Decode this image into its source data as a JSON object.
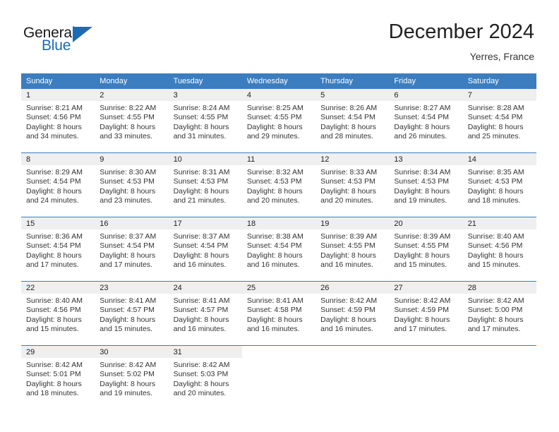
{
  "brand": {
    "name_part1": "General",
    "name_part2": "Blue",
    "triangle_icon": "triangle-icon",
    "accent_color": "#1b6cb5"
  },
  "header": {
    "title": "December 2024",
    "subtitle": "Yerres, France"
  },
  "theme": {
    "header_blue": "#3b7dbf",
    "daynum_band": "#efefef",
    "text": "#333333"
  },
  "weekday_headers": [
    "Sunday",
    "Monday",
    "Tuesday",
    "Wednesday",
    "Thursday",
    "Friday",
    "Saturday"
  ],
  "weeks": [
    [
      {
        "day": "1",
        "sunrise": "Sunrise: 8:21 AM",
        "sunset": "Sunset: 4:56 PM",
        "daylight_1": "Daylight: 8 hours",
        "daylight_2": "and 34 minutes."
      },
      {
        "day": "2",
        "sunrise": "Sunrise: 8:22 AM",
        "sunset": "Sunset: 4:55 PM",
        "daylight_1": "Daylight: 8 hours",
        "daylight_2": "and 33 minutes."
      },
      {
        "day": "3",
        "sunrise": "Sunrise: 8:24 AM",
        "sunset": "Sunset: 4:55 PM",
        "daylight_1": "Daylight: 8 hours",
        "daylight_2": "and 31 minutes."
      },
      {
        "day": "4",
        "sunrise": "Sunrise: 8:25 AM",
        "sunset": "Sunset: 4:55 PM",
        "daylight_1": "Daylight: 8 hours",
        "daylight_2": "and 29 minutes."
      },
      {
        "day": "5",
        "sunrise": "Sunrise: 8:26 AM",
        "sunset": "Sunset: 4:54 PM",
        "daylight_1": "Daylight: 8 hours",
        "daylight_2": "and 28 minutes."
      },
      {
        "day": "6",
        "sunrise": "Sunrise: 8:27 AM",
        "sunset": "Sunset: 4:54 PM",
        "daylight_1": "Daylight: 8 hours",
        "daylight_2": "and 26 minutes."
      },
      {
        "day": "7",
        "sunrise": "Sunrise: 8:28 AM",
        "sunset": "Sunset: 4:54 PM",
        "daylight_1": "Daylight: 8 hours",
        "daylight_2": "and 25 minutes."
      }
    ],
    [
      {
        "day": "8",
        "sunrise": "Sunrise: 8:29 AM",
        "sunset": "Sunset: 4:54 PM",
        "daylight_1": "Daylight: 8 hours",
        "daylight_2": "and 24 minutes."
      },
      {
        "day": "9",
        "sunrise": "Sunrise: 8:30 AM",
        "sunset": "Sunset: 4:53 PM",
        "daylight_1": "Daylight: 8 hours",
        "daylight_2": "and 23 minutes."
      },
      {
        "day": "10",
        "sunrise": "Sunrise: 8:31 AM",
        "sunset": "Sunset: 4:53 PM",
        "daylight_1": "Daylight: 8 hours",
        "daylight_2": "and 21 minutes."
      },
      {
        "day": "11",
        "sunrise": "Sunrise: 8:32 AM",
        "sunset": "Sunset: 4:53 PM",
        "daylight_1": "Daylight: 8 hours",
        "daylight_2": "and 20 minutes."
      },
      {
        "day": "12",
        "sunrise": "Sunrise: 8:33 AM",
        "sunset": "Sunset: 4:53 PM",
        "daylight_1": "Daylight: 8 hours",
        "daylight_2": "and 20 minutes."
      },
      {
        "day": "13",
        "sunrise": "Sunrise: 8:34 AM",
        "sunset": "Sunset: 4:53 PM",
        "daylight_1": "Daylight: 8 hours",
        "daylight_2": "and 19 minutes."
      },
      {
        "day": "14",
        "sunrise": "Sunrise: 8:35 AM",
        "sunset": "Sunset: 4:53 PM",
        "daylight_1": "Daylight: 8 hours",
        "daylight_2": "and 18 minutes."
      }
    ],
    [
      {
        "day": "15",
        "sunrise": "Sunrise: 8:36 AM",
        "sunset": "Sunset: 4:54 PM",
        "daylight_1": "Daylight: 8 hours",
        "daylight_2": "and 17 minutes."
      },
      {
        "day": "16",
        "sunrise": "Sunrise: 8:37 AM",
        "sunset": "Sunset: 4:54 PM",
        "daylight_1": "Daylight: 8 hours",
        "daylight_2": "and 17 minutes."
      },
      {
        "day": "17",
        "sunrise": "Sunrise: 8:37 AM",
        "sunset": "Sunset: 4:54 PM",
        "daylight_1": "Daylight: 8 hours",
        "daylight_2": "and 16 minutes."
      },
      {
        "day": "18",
        "sunrise": "Sunrise: 8:38 AM",
        "sunset": "Sunset: 4:54 PM",
        "daylight_1": "Daylight: 8 hours",
        "daylight_2": "and 16 minutes."
      },
      {
        "day": "19",
        "sunrise": "Sunrise: 8:39 AM",
        "sunset": "Sunset: 4:55 PM",
        "daylight_1": "Daylight: 8 hours",
        "daylight_2": "and 16 minutes."
      },
      {
        "day": "20",
        "sunrise": "Sunrise: 8:39 AM",
        "sunset": "Sunset: 4:55 PM",
        "daylight_1": "Daylight: 8 hours",
        "daylight_2": "and 15 minutes."
      },
      {
        "day": "21",
        "sunrise": "Sunrise: 8:40 AM",
        "sunset": "Sunset: 4:56 PM",
        "daylight_1": "Daylight: 8 hours",
        "daylight_2": "and 15 minutes."
      }
    ],
    [
      {
        "day": "22",
        "sunrise": "Sunrise: 8:40 AM",
        "sunset": "Sunset: 4:56 PM",
        "daylight_1": "Daylight: 8 hours",
        "daylight_2": "and 15 minutes."
      },
      {
        "day": "23",
        "sunrise": "Sunrise: 8:41 AM",
        "sunset": "Sunset: 4:57 PM",
        "daylight_1": "Daylight: 8 hours",
        "daylight_2": "and 15 minutes."
      },
      {
        "day": "24",
        "sunrise": "Sunrise: 8:41 AM",
        "sunset": "Sunset: 4:57 PM",
        "daylight_1": "Daylight: 8 hours",
        "daylight_2": "and 16 minutes."
      },
      {
        "day": "25",
        "sunrise": "Sunrise: 8:41 AM",
        "sunset": "Sunset: 4:58 PM",
        "daylight_1": "Daylight: 8 hours",
        "daylight_2": "and 16 minutes."
      },
      {
        "day": "26",
        "sunrise": "Sunrise: 8:42 AM",
        "sunset": "Sunset: 4:59 PM",
        "daylight_1": "Daylight: 8 hours",
        "daylight_2": "and 16 minutes."
      },
      {
        "day": "27",
        "sunrise": "Sunrise: 8:42 AM",
        "sunset": "Sunset: 4:59 PM",
        "daylight_1": "Daylight: 8 hours",
        "daylight_2": "and 17 minutes."
      },
      {
        "day": "28",
        "sunrise": "Sunrise: 8:42 AM",
        "sunset": "Sunset: 5:00 PM",
        "daylight_1": "Daylight: 8 hours",
        "daylight_2": "and 17 minutes."
      }
    ],
    [
      {
        "day": "29",
        "sunrise": "Sunrise: 8:42 AM",
        "sunset": "Sunset: 5:01 PM",
        "daylight_1": "Daylight: 8 hours",
        "daylight_2": "and 18 minutes."
      },
      {
        "day": "30",
        "sunrise": "Sunrise: 8:42 AM",
        "sunset": "Sunset: 5:02 PM",
        "daylight_1": "Daylight: 8 hours",
        "daylight_2": "and 19 minutes."
      },
      {
        "day": "31",
        "sunrise": "Sunrise: 8:42 AM",
        "sunset": "Sunset: 5:03 PM",
        "daylight_1": "Daylight: 8 hours",
        "daylight_2": "and 20 minutes."
      },
      {
        "day": "",
        "sunrise": "",
        "sunset": "",
        "daylight_1": "",
        "daylight_2": ""
      },
      {
        "day": "",
        "sunrise": "",
        "sunset": "",
        "daylight_1": "",
        "daylight_2": ""
      },
      {
        "day": "",
        "sunrise": "",
        "sunset": "",
        "daylight_1": "",
        "daylight_2": ""
      },
      {
        "day": "",
        "sunrise": "",
        "sunset": "",
        "daylight_1": "",
        "daylight_2": ""
      }
    ]
  ]
}
